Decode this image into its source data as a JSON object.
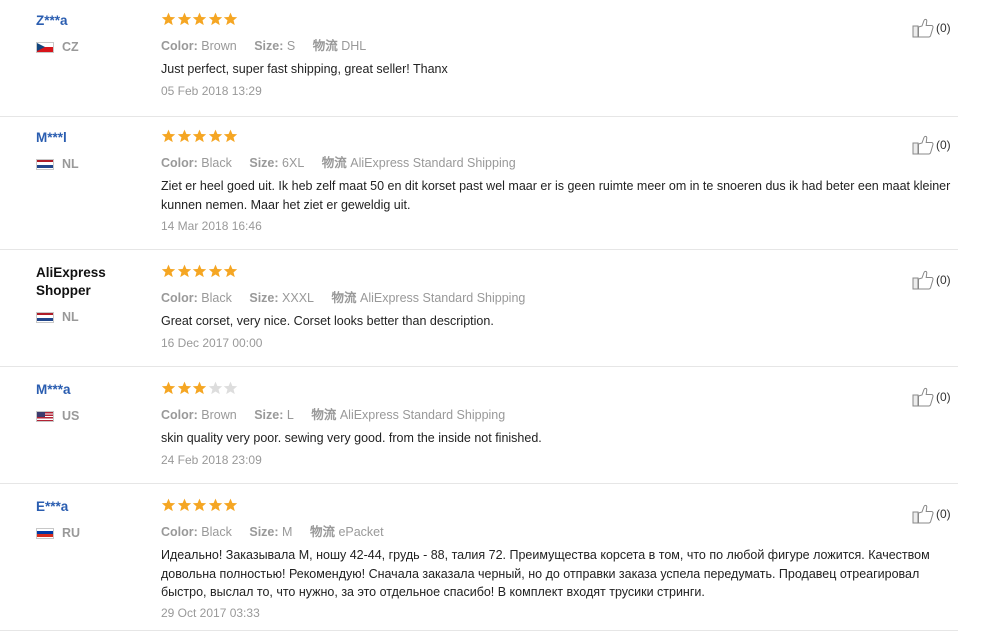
{
  "labels": {
    "color": "Color:",
    "size": "Size:",
    "shipping": "物流"
  },
  "reviews": [
    {
      "user": "Z***a",
      "country": "CZ",
      "flag": "cz",
      "stars": 5,
      "color": "Brown",
      "size": "S",
      "shipping": "DHL",
      "text": "Just perfect, super fast shipping, great seller! Thanx",
      "date": "05 Feb 2018 13:29",
      "likes": "(0)"
    },
    {
      "user": "M***l",
      "country": "NL",
      "flag": "nl",
      "stars": 5,
      "color": "Black",
      "size": "6XL",
      "shipping": "AliExpress Standard Shipping",
      "text": "Ziet er heel goed uit. Ik heb zelf maat 50 en dit korset past wel maar er is geen ruimte meer om in te snoeren dus ik had beter een maat kleiner kunnen nemen. Maar het ziet er geweldig uit.",
      "date": "14 Mar 2018 16:46",
      "likes": "(0)"
    },
    {
      "user": "AliExpress Shopper",
      "country": "NL",
      "flag": "nl",
      "stars": 5,
      "color": "Black",
      "size": "XXXL",
      "shipping": "AliExpress Standard Shipping",
      "text": "Great corset, very nice. Corset looks better than description.",
      "date": "16 Dec 2017 00:00",
      "likes": "(0)"
    },
    {
      "user": "M***a",
      "country": "US",
      "flag": "us",
      "stars": 3,
      "color": "Brown",
      "size": "L",
      "shipping": "AliExpress Standard Shipping",
      "text": "skin quality very poor. sewing very good. from the inside not finished.",
      "date": "24 Feb 2018 23:09",
      "likes": "(0)"
    },
    {
      "user": "E***a",
      "country": "RU",
      "flag": "ru",
      "stars": 5,
      "color": "Black",
      "size": "M",
      "shipping": "ePacket",
      "text": "Идеально! Заказывала М, ношу 42-44, грудь - 88, талия 72. Преимущества корсета в том, что по любой фигуре ложится. Качеством довольна полностью! Рекомендую! Сначала заказала черный, но до отправки заказа успела передумать. Продавец отреагировал быстро, выслал то, что нужно, за это отдельное спасибо! В комплект входят трусики стринги.",
      "date": "29 Oct 2017 03:33",
      "likes": "(0)"
    }
  ],
  "colors": {
    "star_on": "#f5a623",
    "star_off": "#dddddd",
    "user_link": "#2a5db0",
    "muted": "#999999"
  },
  "icons": {
    "like": "thumbs-up-icon",
    "star": "star-icon"
  }
}
